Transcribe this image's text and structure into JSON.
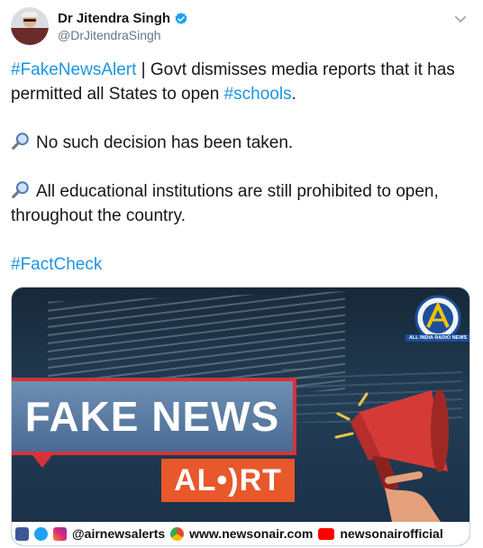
{
  "author": {
    "name": "Dr Jitendra Singh",
    "handle": "@DrJitendraSingh"
  },
  "tweet": {
    "hashtag1": "#FakeNewsAlert",
    "line1_rest": " | Govt dismisses media reports that it has permitted all States to open ",
    "hashtag2": "#schools",
    "line1_end": ".",
    "point1": "No such decision has been taken.",
    "point2": "All educational institutions are still prohibited to open, throughout the country.",
    "hashtag3": "#FactCheck"
  },
  "media": {
    "fake_label": "FAKE NEWS",
    "alert_label": "AL•)RT",
    "logo_caption": "ALL INDIA RADIO NEWS",
    "footer": {
      "handle": "@airnewsalerts",
      "website": "www.newsonair.com",
      "youtube": "newsonairofficial"
    }
  },
  "colors": {
    "link": "#1b95e0",
    "verified": "#1da1f2",
    "fake_border": "#d4333a",
    "alert_bg": "#e8582a"
  },
  "icons": {
    "verified": "verified-badge-icon",
    "caret": "chevron-down-icon",
    "bullet": "magnifying-glass-icon"
  }
}
